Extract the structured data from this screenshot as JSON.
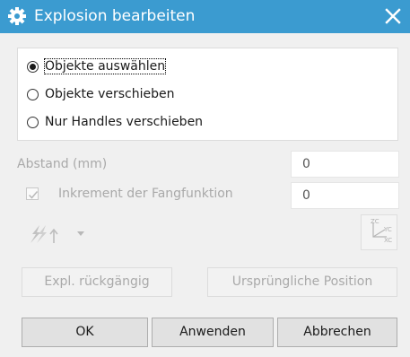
{
  "dialog": {
    "title": "Explosion bearbeiten",
    "title_icon": "gear-icon",
    "close_icon": "close-icon",
    "title_color": "#3b9bd0"
  },
  "radio_options": [
    {
      "label": "Objekte auswählen",
      "checked": true
    },
    {
      "label": "Objekte verschieben",
      "checked": false
    },
    {
      "label": "Nur Handles verschieben",
      "checked": false
    }
  ],
  "fields": {
    "distance_label": "Abstand (mm)",
    "distance_value": "0",
    "increment_label": "Inkrement der Fangfunktion",
    "increment_value": "0",
    "increment_checked": true
  },
  "tools": {
    "orient_icon": "lightning-arrow-icon",
    "csys_icon": "coordinate-system-icon",
    "csys_labels": [
      "ZC",
      "YC",
      "XC"
    ]
  },
  "actions": {
    "undo_explode": "Expl. rückgängig",
    "original_position": "Ursprüngliche Position"
  },
  "footer": {
    "ok": "OK",
    "apply": "Anwenden",
    "cancel": "Abbrechen"
  }
}
